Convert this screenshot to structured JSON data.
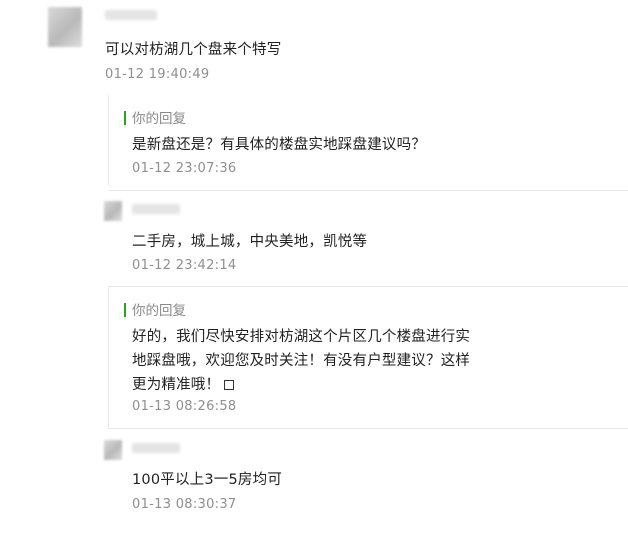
{
  "comment1": {
    "text": "可以对枋湖几个盘来个特写",
    "time": "01-12 19:40:49",
    "reply": {
      "label": "你的回复",
      "text": "是新盘还是？有具体的楼盘实地踩盘建议吗？",
      "time": "01-12 23:07:36"
    }
  },
  "comment2": {
    "text": "二手房，城上城，中央美地，凯悦等",
    "time": "01-12 23:42:14",
    "reply": {
      "label": "你的回复",
      "lines": [
        "好的，我们尽快安排对枋湖这个片区几个楼盘进行实",
        "地踩盘哦，欢迎您及时关注！有没有户型建议？这样",
        "更为精准哦！"
      ],
      "time": "01-13 08:26:58"
    }
  },
  "comment3": {
    "text": "100平以上3一5房均可",
    "time": "01-13 08:30:37"
  },
  "colors": {
    "accent_green": "#2aa515",
    "text": "#222222",
    "time": "#8f8f8f"
  }
}
